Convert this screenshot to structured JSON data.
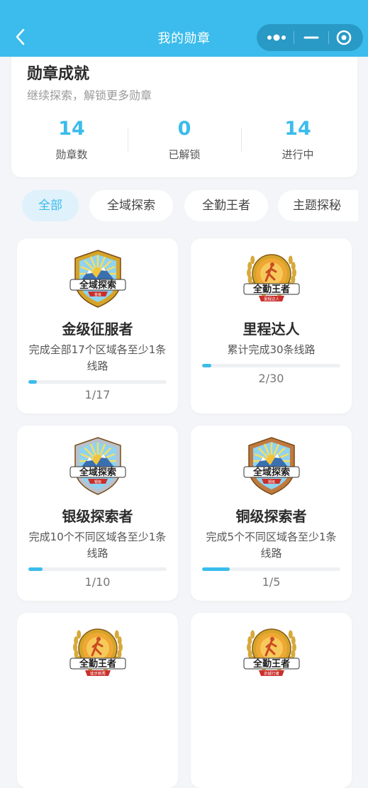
{
  "header": {
    "title": "我的勋章"
  },
  "summary": {
    "title": "勋章成就",
    "subtitle": "继续探索，解锁更多勋章",
    "stats": [
      {
        "value": "14",
        "label": "勋章数"
      },
      {
        "value": "0",
        "label": "已解锁"
      },
      {
        "value": "14",
        "label": "进行中"
      }
    ]
  },
  "tabs": [
    {
      "label": "全部",
      "active": true
    },
    {
      "label": "全域探索",
      "active": false
    },
    {
      "label": "全勤王者",
      "active": false
    },
    {
      "label": "主题探秘",
      "active": false
    }
  ],
  "badges": [
    {
      "name": "金级征服者",
      "desc": "完成全部17个区域各至少1条线路",
      "progress_text": "1/17",
      "progress": 0.059,
      "emblem_title": "全域探索",
      "emblem_sub": "金级",
      "type": "shield",
      "tier_color": "#d4a52a"
    },
    {
      "name": "里程达人",
      "desc": "累计完成30条线路",
      "progress_text": "2/30",
      "progress": 0.067,
      "emblem_title": "全勤王者",
      "emblem_sub": "里程达人",
      "type": "round",
      "tier_color": "#d4a52a"
    },
    {
      "name": "银级探索者",
      "desc": "完成10个不同区域各至少1条线路",
      "progress_text": "1/10",
      "progress": 0.1,
      "emblem_title": "全域探索",
      "emblem_sub": "银级",
      "type": "shield",
      "tier_color": "#b8c2cc"
    },
    {
      "name": "铜级探索者",
      "desc": "完成5个不同区域各至少1条线路",
      "progress_text": "1/5",
      "progress": 0.2,
      "emblem_title": "全域探索",
      "emblem_sub": "铜级",
      "type": "shield",
      "tier_color": "#c07a3f"
    },
    {
      "name": "",
      "desc": "",
      "progress_text": "",
      "progress": 0,
      "emblem_title": "全勤王者",
      "emblem_sub": "徒步新秀",
      "type": "round",
      "tier_color": "#d4a52a"
    },
    {
      "name": "",
      "desc": "",
      "progress_text": "",
      "progress": 0,
      "emblem_title": "全勤王者",
      "emblem_sub": "京城行者",
      "type": "round",
      "tier_color": "#d4a52a"
    }
  ],
  "colors": {
    "accent": "#3bbcec",
    "background": "#f3f5f8"
  },
  "icons": {
    "back": "chevron-left-icon",
    "more": "more-dots-icon",
    "minimize": "minimize-icon",
    "close": "target-close-icon"
  }
}
